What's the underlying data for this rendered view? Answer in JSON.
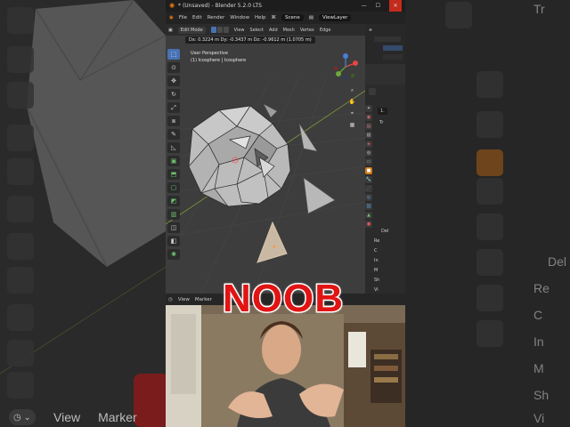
{
  "window": {
    "title": "* (Unsaved) - Blender 5.2.0 LTS",
    "controls": [
      "—",
      "☐",
      "✕"
    ]
  },
  "menubar": {
    "items": [
      "File",
      "Edit",
      "Render",
      "Window",
      "Help"
    ],
    "scene_label": "Scene",
    "view_layer_label": "ViewLayer"
  },
  "viewport_header": {
    "mode": "Edit Mode",
    "items": [
      "View",
      "Select",
      "Add",
      "Mesh",
      "Vertex",
      "Edge"
    ]
  },
  "transform_readout": "Dx: 0.3224 m  Dy: -0.3437 m  Dz: -0.9612 m (1.0705 m)",
  "viewport_info": {
    "view_name": "User Perspective",
    "object_line": "(1) Icosphere | Icosphere"
  },
  "timeline_header": {
    "items": [
      "View",
      "Marker"
    ]
  },
  "properties": {
    "field_value": "1.",
    "section_label": "Tr",
    "collapsed_label": "Del",
    "rows": [
      "Re",
      "C",
      "In",
      "M",
      "Sh",
      "Vi"
    ]
  },
  "caption": "NOOB",
  "background": {
    "left_labels": [
      "View",
      "Marker"
    ],
    "right_labels": [
      "Tr",
      "Del",
      "Re",
      "C",
      "In",
      "M",
      "Sh",
      "Vi"
    ]
  },
  "colors": {
    "accent_blue": "#4772b3",
    "caption_red": "#e11414",
    "close_red": "#c42b1c",
    "blender_orange": "#e87d0d"
  }
}
